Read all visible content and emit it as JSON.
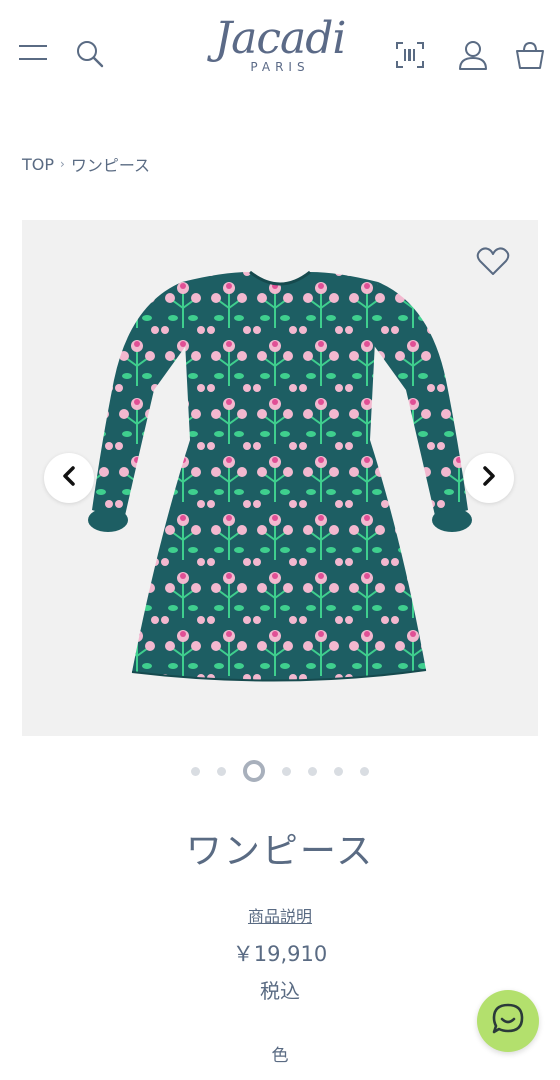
{
  "header": {
    "menu_icon": "hamburger-icon",
    "search_icon": "search-icon",
    "logo_word": "Jacadi",
    "logo_sub": "PARIS",
    "barcode_icon": "barcode-scan-icon",
    "account_icon": "user-icon",
    "cart_icon": "basket-icon"
  },
  "breadcrumb": {
    "home": "TOP",
    "separator": "›",
    "current": "ワンピース"
  },
  "gallery": {
    "favorite_icon": "heart-icon",
    "prev_icon": "chevron-left-icon",
    "next_icon": "chevron-right-icon",
    "image_alt": "dress-image",
    "slide_count": 7,
    "active_slide": 3
  },
  "product": {
    "title": "ワンピース",
    "description_link": "商品説明",
    "price": "￥19,910",
    "tax_note": "税込",
    "color_label": "色"
  },
  "chat": {
    "icon": "chat-icon"
  },
  "colors": {
    "text": "#5a6b83",
    "dress_base": "#1d5e63",
    "chat_bg": "#b3e06d"
  }
}
